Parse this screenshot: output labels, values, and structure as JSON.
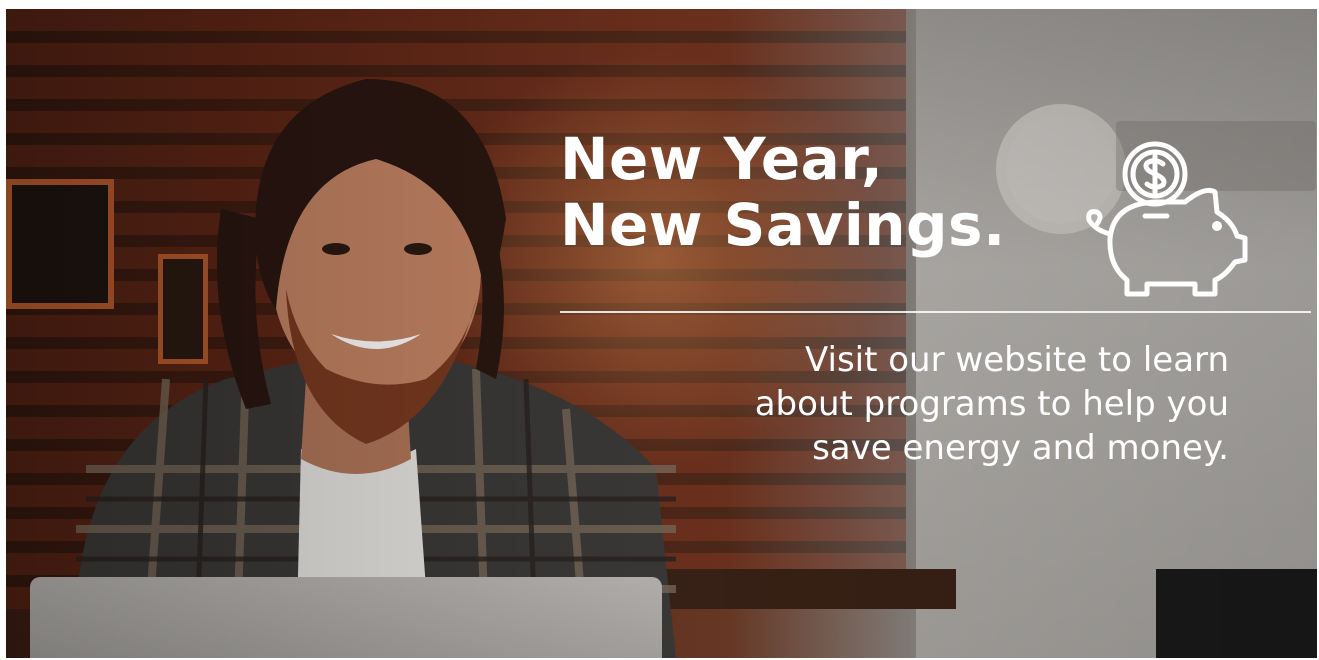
{
  "headline": {
    "line1": "New Year,",
    "line2": "New Savings."
  },
  "body": {
    "line1": "Visit our website to learn",
    "line2": "about programs to help you",
    "line3": "save energy and money."
  },
  "icons": {
    "piggy": "piggy-bank-icon",
    "coin": "dollar-coin-icon"
  },
  "colors": {
    "text": "#ffffff",
    "accent_wood": "#b85a2a"
  }
}
